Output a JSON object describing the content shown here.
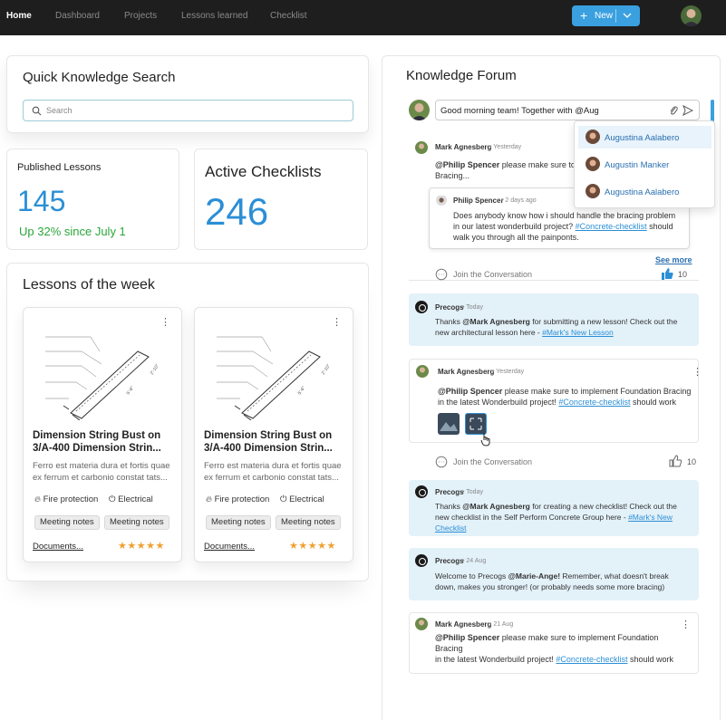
{
  "nav": {
    "items": [
      "Home",
      "Dashboard",
      "Projects",
      "Lessons learned",
      "Checklist"
    ],
    "new_button": "New"
  },
  "search": {
    "title": "Quick Knowledge Search",
    "placeholder": "Search"
  },
  "stats": {
    "published": {
      "label": "Published Lessons",
      "value": "145",
      "delta": "Up 32% since July 1"
    },
    "checklists": {
      "label": "Active Checklists",
      "value": "246"
    }
  },
  "lessons": {
    "title": "Lessons of the week",
    "cards": [
      {
        "title_line1": "Dimension String Bust on",
        "title_line2": "3/A-400 Dimension Strin...",
        "desc_line1": "Ferro est materia dura et fortis quae",
        "desc_line2": "ex ferrum et carbonio constat tats...",
        "tag1": "Fire protection",
        "tag2": "Electrical",
        "chip1": "Meeting notes",
        "chip2": "Meeting notes",
        "link": "Documents...",
        "stars": "★★★★★"
      },
      {
        "title_line1": "Dimension String Bust on",
        "title_line2": "3/A-400 Dimension Strin...",
        "desc_line1": "Ferro est materia dura et fortis quae",
        "desc_line2": "ex ferrum et carbonio constat tats...",
        "tag1": "Fire protection",
        "tag2": "Electrical",
        "chip1": "Meeting notes",
        "chip2": "Meeting notes",
        "link": "Documents...",
        "stars": "★★★★★"
      }
    ]
  },
  "forum": {
    "title": "Knowledge Forum",
    "compose_value": "Good morning team! Together with @Aug",
    "mentions": [
      "Augustina Aalabero",
      "Augustin Manker",
      "Augustina Aalabero"
    ],
    "post1": {
      "author": "Mark Agnesberg",
      "time": "Yesterday",
      "mention": "@Philip Spencer",
      "text_a": " please make sure to",
      "text_b": "Bracing...",
      "reply_author": "Philip Spencer",
      "reply_time": "2 days ago",
      "reply_line1": "Does anybody know how i should handle the bracing problem",
      "reply_line2_a": "in our latest wonderbuild project? ",
      "reply_link": "#Concrete-checklist",
      "reply_line2_b": " should",
      "reply_line3": "walk you through all the painponts.",
      "see_more": "See more",
      "join": "Join the Conversation",
      "likes": "10"
    },
    "post2": {
      "author": "Precogs",
      "time": "Today",
      "t1": "Thanks ",
      "b1": "@Mark Agnesberg",
      "t2": " for submitting a new lesson! Check out the",
      "t3": "new architectural lesson here - ",
      "link": "#Mark's New Lesson"
    },
    "post3": {
      "author": "Mark Agnesberg",
      "time": "Yesterday",
      "mention": "@Philip Spencer",
      "t1": " please make sure to implement Foundation Bracing",
      "t2": "in the latest Wonderbuild project! ",
      "link": "#Concrete-checklist",
      "t3": " should work",
      "join": "Join the Conversation",
      "likes": "10"
    },
    "post4": {
      "author": "Precogs",
      "time": "Today",
      "t1": "Thanks ",
      "b1": "@Mark Agnesberg",
      "t2": " for creating a new checklist! Check out the",
      "t3": "new checklist in the Self Perform Concrete Group here - ",
      "link1": "#Mark's New",
      "link2": "Checklist"
    },
    "post5": {
      "author": "Precogs",
      "time": "24 Aug",
      "t1": "Welcome to Precogs ",
      "b1": "@Marie-Ange!",
      "t2": " Remember, what doesn't break",
      "t3": "down, makes you stronger! (or probably needs some more bracing)"
    },
    "post6": {
      "author": "Mark Agnesberg",
      "time": "21 Aug",
      "mention": "@Philip Spencer",
      "t1": " please make sure to implement Foundation",
      "t2": "Bracing",
      "t3": "in the latest Wonderbuild project! ",
      "link": "#Concrete-checklist",
      "t4": " should work"
    }
  },
  "colors": {
    "accent": "#2b8fd6",
    "positive": "#2aa63a",
    "nav_bg": "#1e1e1e",
    "bot_bg": "#e3f1f9",
    "star": "#f0a030"
  }
}
